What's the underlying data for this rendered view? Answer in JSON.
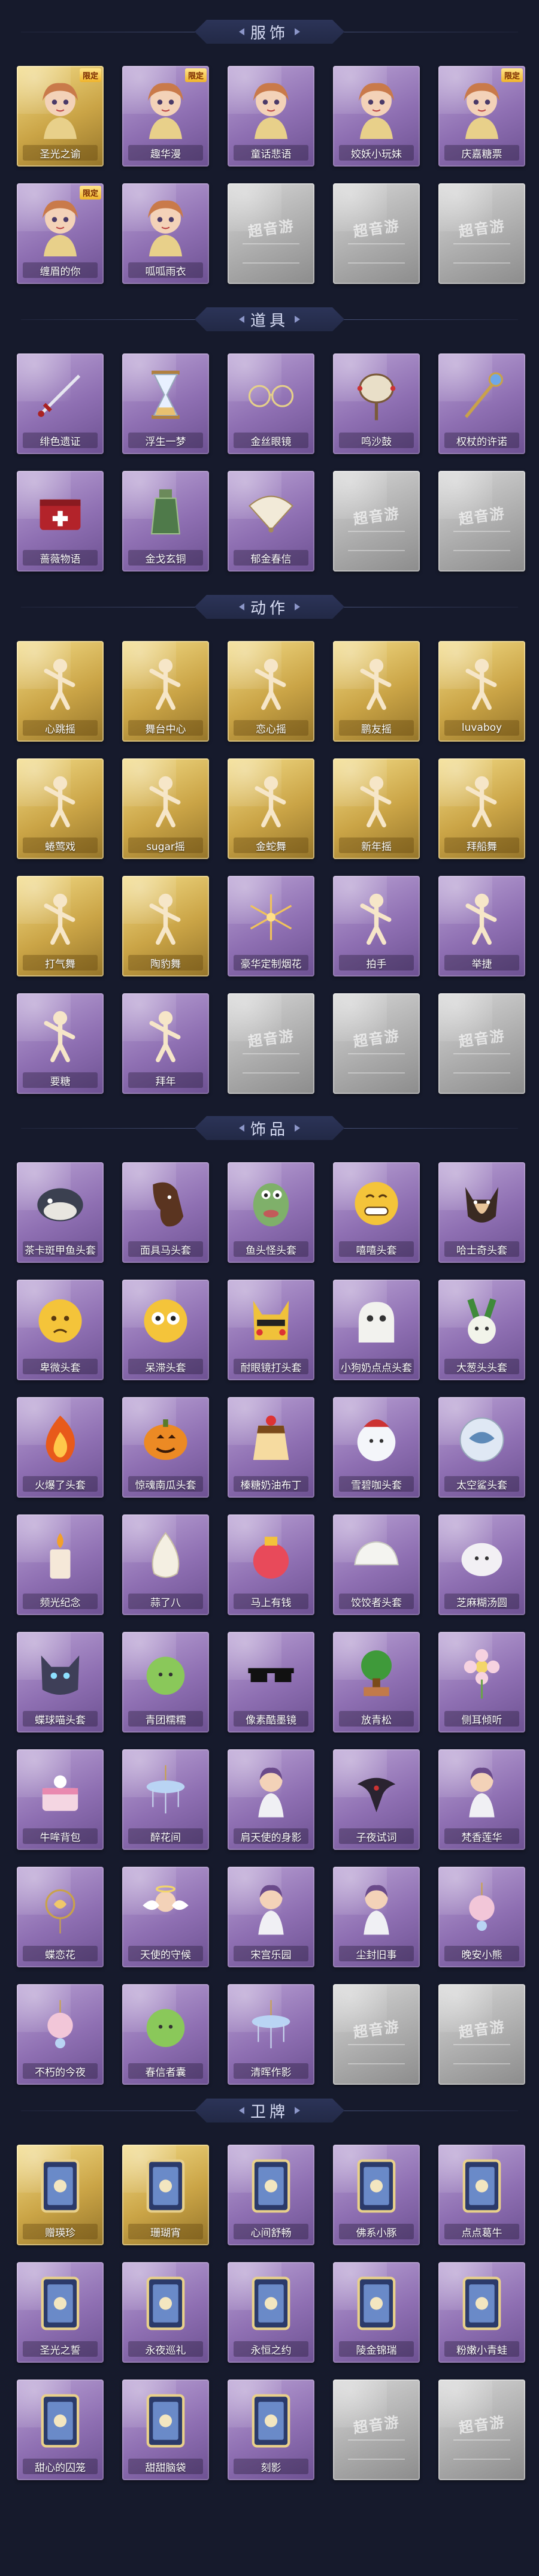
{
  "colors": {
    "background": "#161a2c",
    "header_banner": "#262d4d",
    "card_purple": "#9a7cbd",
    "card_gold": "#d8b455",
    "card_empty": "#b8b8b8"
  },
  "empty_watermark": "超音游",
  "sections": [
    {
      "title": "服饰",
      "items": [
        {
          "label": "圣光之谕",
          "tier": "gold",
          "tag": "限定",
          "icon": "character"
        },
        {
          "label": "趣华漫",
          "tier": "purple",
          "tag": "限定",
          "icon": "character"
        },
        {
          "label": "童话悲语",
          "tier": "purple",
          "tag": "",
          "icon": "character"
        },
        {
          "label": "姣妖小玩妹",
          "tier": "purple",
          "tag": "",
          "icon": "character"
        },
        {
          "label": "庆嘉糖票",
          "tier": "purple",
          "tag": "限定",
          "icon": "character"
        },
        {
          "label": "缠眉的你",
          "tier": "purple",
          "tag": "限定",
          "icon": "character"
        },
        {
          "label": "呱呱雨衣",
          "tier": "purple",
          "tag": "",
          "icon": "character"
        },
        {
          "label": "",
          "tier": "empty",
          "tag": "",
          "icon": "empty"
        },
        {
          "label": "",
          "tier": "empty",
          "tag": "",
          "icon": "empty"
        },
        {
          "label": "",
          "tier": "empty",
          "tag": "",
          "icon": "empty"
        }
      ]
    },
    {
      "title": "道具",
      "items": [
        {
          "label": "绯色遗证",
          "tier": "purple",
          "tag": "",
          "icon": "sword"
        },
        {
          "label": "浮生一梦",
          "tier": "purple",
          "tag": "",
          "icon": "hourglass"
        },
        {
          "label": "金丝眼镜",
          "tier": "purple",
          "tag": "",
          "icon": "glasses"
        },
        {
          "label": "鸣沙鼓",
          "tier": "purple",
          "tag": "",
          "icon": "drum"
        },
        {
          "label": "权杖的许诺",
          "tier": "purple",
          "tag": "",
          "icon": "scepter"
        },
        {
          "label": "蔷薇物语",
          "tier": "purple",
          "tag": "",
          "icon": "box"
        },
        {
          "label": "金戈玄铜",
          "tier": "purple",
          "tag": "",
          "icon": "bottle"
        },
        {
          "label": "郁金春信",
          "tier": "purple",
          "tag": "",
          "icon": "fan"
        },
        {
          "label": "",
          "tier": "empty",
          "tag": "",
          "icon": "empty"
        },
        {
          "label": "",
          "tier": "empty",
          "tag": "",
          "icon": "empty"
        }
      ]
    },
    {
      "title": "动作",
      "items": [
        {
          "label": "心跳摇",
          "tier": "gold",
          "tag": "",
          "icon": "pose"
        },
        {
          "label": "舞台中心",
          "tier": "gold",
          "tag": "",
          "icon": "pose"
        },
        {
          "label": "恋心摇",
          "tier": "gold",
          "tag": "",
          "icon": "pose"
        },
        {
          "label": "鹏友摇",
          "tier": "gold",
          "tag": "",
          "icon": "pose"
        },
        {
          "label": "luvaboy",
          "tier": "gold",
          "tag": "",
          "icon": "pose"
        },
        {
          "label": "蜷莺戏",
          "tier": "gold",
          "tag": "",
          "icon": "pose"
        },
        {
          "label": "sugar摇",
          "tier": "gold",
          "tag": "",
          "icon": "pose"
        },
        {
          "label": "金蛇舞",
          "tier": "gold",
          "tag": "",
          "icon": "pose"
        },
        {
          "label": "新年摇",
          "tier": "gold",
          "tag": "",
          "icon": "pose"
        },
        {
          "label": "拜船舞",
          "tier": "gold",
          "tag": "",
          "icon": "pose"
        },
        {
          "label": "打气舞",
          "tier": "gold",
          "tag": "",
          "icon": "pose"
        },
        {
          "label": "陶豹舞",
          "tier": "gold",
          "tag": "",
          "icon": "pose"
        },
        {
          "label": "豪华定制烟花",
          "tier": "purple",
          "tag": "",
          "icon": "firework"
        },
        {
          "label": "拍手",
          "tier": "purple",
          "tag": "",
          "icon": "pose"
        },
        {
          "label": "举捷",
          "tier": "purple",
          "tag": "",
          "icon": "pose"
        },
        {
          "label": "要糖",
          "tier": "purple",
          "tag": "",
          "icon": "pose"
        },
        {
          "label": "拜年",
          "tier": "purple",
          "tag": "",
          "icon": "pose"
        },
        {
          "label": "",
          "tier": "empty",
          "tag": "",
          "icon": "empty"
        },
        {
          "label": "",
          "tier": "empty",
          "tag": "",
          "icon": "empty"
        },
        {
          "label": "",
          "tier": "empty",
          "tag": "",
          "icon": "empty"
        }
      ]
    },
    {
      "title": "饰品",
      "items": [
        {
          "label": "茶卡斑甲鱼头套",
          "tier": "purple",
          "tag": "",
          "icon": "fish"
        },
        {
          "label": "面具马头套",
          "tier": "purple",
          "tag": "",
          "icon": "horse"
        },
        {
          "label": "鱼头怪头套",
          "tier": "purple",
          "tag": "",
          "icon": "fishface"
        },
        {
          "label": "嘻嘻头套",
          "tier": "purple",
          "tag": "",
          "icon": "grin"
        },
        {
          "label": "哈士奇头套",
          "tier": "purple",
          "tag": "",
          "icon": "dog"
        },
        {
          "label": "卑微头套",
          "tier": "purple",
          "tag": "",
          "icon": "sad"
        },
        {
          "label": "呆滞头套",
          "tier": "purple",
          "tag": "",
          "icon": "dazed"
        },
        {
          "label": "耐眼镜打头套",
          "tier": "purple",
          "tag": "",
          "icon": "pika"
        },
        {
          "label": "小狗奶点点头套",
          "tier": "purple",
          "tag": "",
          "icon": "ghost"
        },
        {
          "label": "大葱头头套",
          "tier": "purple",
          "tag": "",
          "icon": "leek"
        },
        {
          "label": "火爆了头套",
          "tier": "purple",
          "tag": "",
          "icon": "flame"
        },
        {
          "label": "惊魂南瓜头套",
          "tier": "purple",
          "tag": "",
          "icon": "pumpkin"
        },
        {
          "label": "榛糖奶油布丁",
          "tier": "purple",
          "tag": "",
          "icon": "pudding"
        },
        {
          "label": "雪碧咖头套",
          "tier": "purple",
          "tag": "",
          "icon": "snow"
        },
        {
          "label": "太空鲨头套",
          "tier": "purple",
          "tag": "",
          "icon": "shark"
        },
        {
          "label": "频光纪念",
          "tier": "purple",
          "tag": "",
          "icon": "candle"
        },
        {
          "label": "蒜了八",
          "tier": "purple",
          "tag": "",
          "icon": "garlic"
        },
        {
          "label": "马上有钱",
          "tier": "purple",
          "tag": "",
          "icon": "bag"
        },
        {
          "label": "饺饺者头套",
          "tier": "purple",
          "tag": "",
          "icon": "dumpling"
        },
        {
          "label": "芝麻糊汤圆",
          "tier": "purple",
          "tag": "",
          "icon": "blob"
        },
        {
          "label": "蝶球喵头套",
          "tier": "purple",
          "tag": "",
          "icon": "cat"
        },
        {
          "label": "青团糯糯",
          "tier": "purple",
          "tag": "",
          "icon": "green"
        },
        {
          "label": "像素酷墨镜",
          "tier": "purple",
          "tag": "",
          "icon": "shades"
        },
        {
          "label": "放青松",
          "tier": "purple",
          "tag": "",
          "icon": "tree"
        },
        {
          "label": "侧耳倾听",
          "tier": "purple",
          "tag": "",
          "icon": "flower"
        },
        {
          "label": "牛哞背包",
          "tier": "purple",
          "tag": "",
          "icon": "cake"
        },
        {
          "label": "醉花间",
          "tier": "purple",
          "tag": "",
          "icon": "chandelier"
        },
        {
          "label": "肩天使的身影",
          "tier": "purple",
          "tag": "",
          "icon": "doll"
        },
        {
          "label": "子夜试词",
          "tier": "purple",
          "tag": "",
          "icon": "bird"
        },
        {
          "label": "梵香莲华",
          "tier": "purple",
          "tag": "",
          "icon": "doll"
        },
        {
          "label": "蝶恋花",
          "tier": "purple",
          "tag": "",
          "icon": "lantern"
        },
        {
          "label": "天使的守候",
          "tier": "purple",
          "tag": "",
          "icon": "angel"
        },
        {
          "label": "宋宫乐园",
          "tier": "purple",
          "tag": "",
          "icon": "doll"
        },
        {
          "label": "尘封旧事",
          "tier": "purple",
          "tag": "",
          "icon": "doll"
        },
        {
          "label": "晚安小熊",
          "tier": "purple",
          "tag": "",
          "icon": "charm"
        },
        {
          "label": "不朽的今夜",
          "tier": "purple",
          "tag": "",
          "icon": "charm"
        },
        {
          "label": "春信者囊",
          "tier": "purple",
          "tag": "",
          "icon": "green"
        },
        {
          "label": "清晖作影",
          "tier": "purple",
          "tag": "",
          "icon": "chandelier"
        },
        {
          "label": "",
          "tier": "empty",
          "tag": "",
          "icon": "empty"
        },
        {
          "label": "",
          "tier": "empty",
          "tag": "",
          "icon": "empty"
        }
      ]
    },
    {
      "title": "卫牌",
      "items": [
        {
          "label": "赠瑛珍",
          "tier": "gold",
          "tag": "",
          "icon": "card"
        },
        {
          "label": "珊瑚宵",
          "tier": "gold",
          "tag": "",
          "icon": "card"
        },
        {
          "label": "心间舒畅",
          "tier": "purple",
          "tag": "",
          "icon": "card"
        },
        {
          "label": "佛系小豚",
          "tier": "purple",
          "tag": "",
          "icon": "card"
        },
        {
          "label": "点点葛牛",
          "tier": "purple",
          "tag": "",
          "icon": "card"
        },
        {
          "label": "圣光之誓",
          "tier": "purple",
          "tag": "",
          "icon": "card"
        },
        {
          "label": "永夜巡礼",
          "tier": "purple",
          "tag": "",
          "icon": "card"
        },
        {
          "label": "永恒之约",
          "tier": "purple",
          "tag": "",
          "icon": "card"
        },
        {
          "label": "陵金锦瑞",
          "tier": "purple",
          "tag": "",
          "icon": "card"
        },
        {
          "label": "粉嫩小青蛙",
          "tier": "purple",
          "tag": "",
          "icon": "card"
        },
        {
          "label": "甜心的囚笼",
          "tier": "purple",
          "tag": "",
          "icon": "card"
        },
        {
          "label": "甜甜脑袋",
          "tier": "purple",
          "tag": "",
          "icon": "card"
        },
        {
          "label": "刻影",
          "tier": "purple",
          "tag": "",
          "icon": "card"
        },
        {
          "label": "",
          "tier": "empty",
          "tag": "",
          "icon": "empty"
        },
        {
          "label": "",
          "tier": "empty",
          "tag": "",
          "icon": "empty"
        }
      ]
    }
  ]
}
